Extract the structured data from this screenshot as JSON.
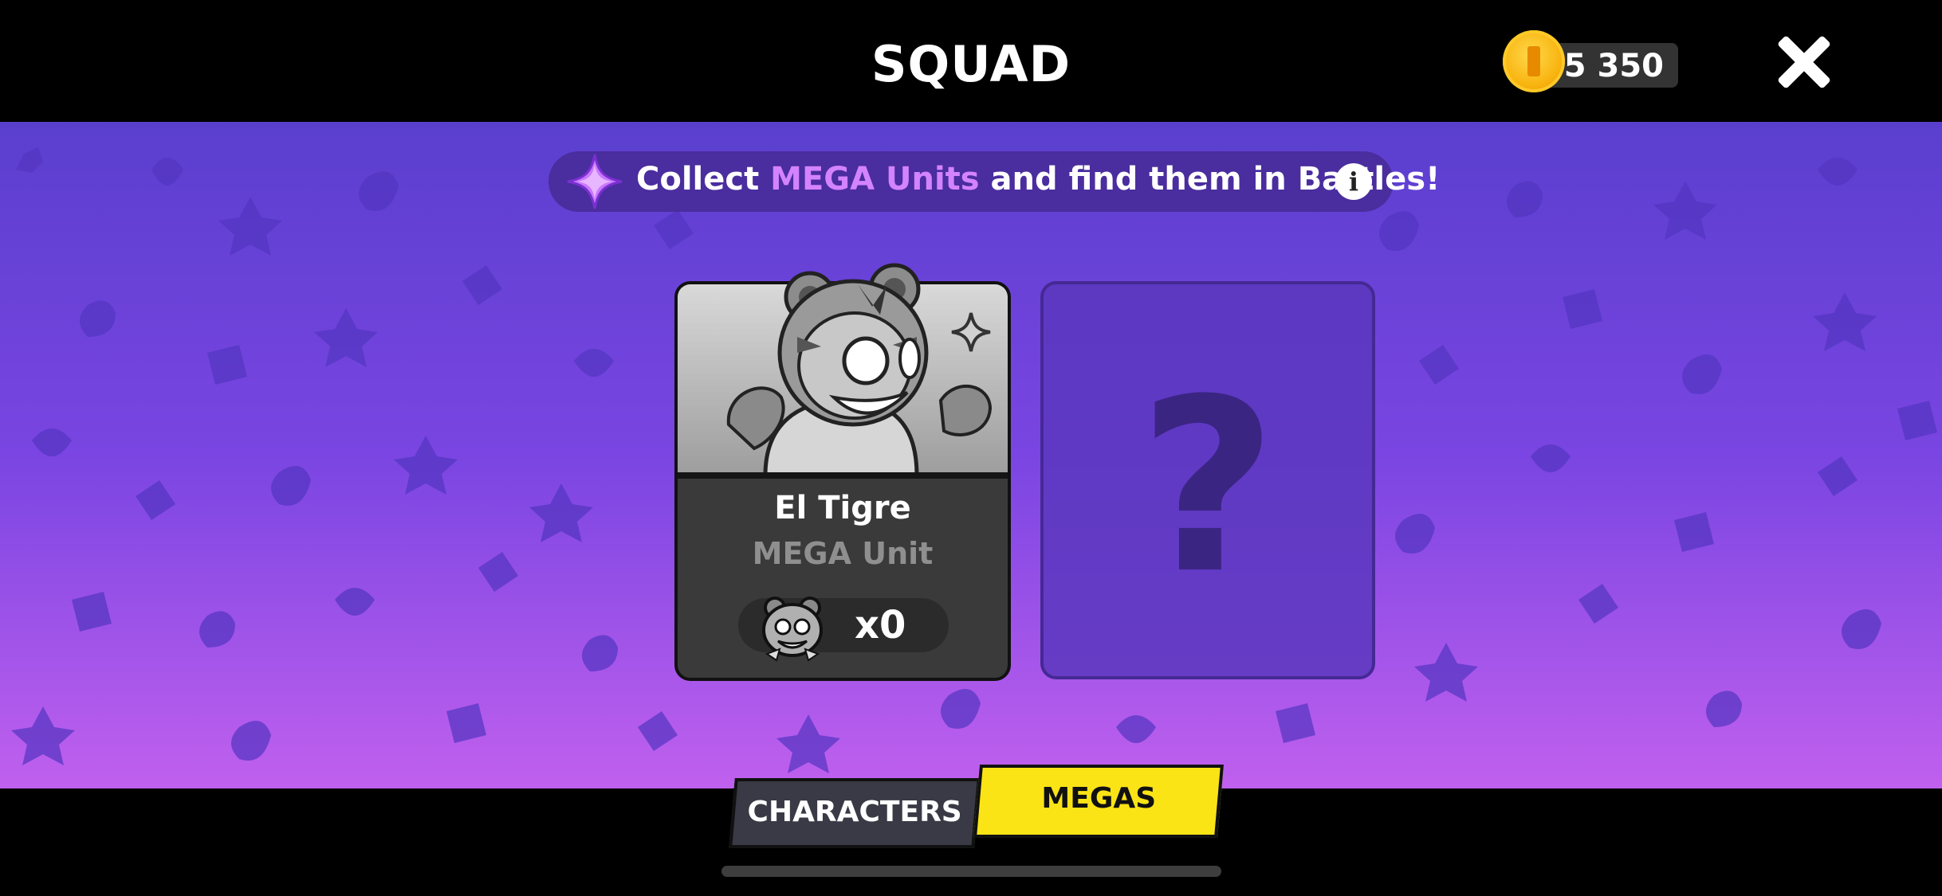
{
  "header": {
    "title": "SQUAD",
    "coins": "5 350"
  },
  "banner": {
    "text_before": "Collect ",
    "highlight": "MEGA Units",
    "text_after": " and find them in Battles!",
    "info_icon": "i"
  },
  "cards": [
    {
      "name": "El Tigre",
      "type": "MEGA Unit",
      "count": "x0",
      "state": "collected-greyscale"
    },
    {
      "state": "locked",
      "placeholder": "?"
    }
  ],
  "tabs": {
    "characters": "CHARACTERS",
    "megas": "MEGAS",
    "active": "megas"
  },
  "colors": {
    "accent_yellow": "#fbe416",
    "highlight_purple": "#d483ff",
    "coin_gold": "#f8b410"
  }
}
